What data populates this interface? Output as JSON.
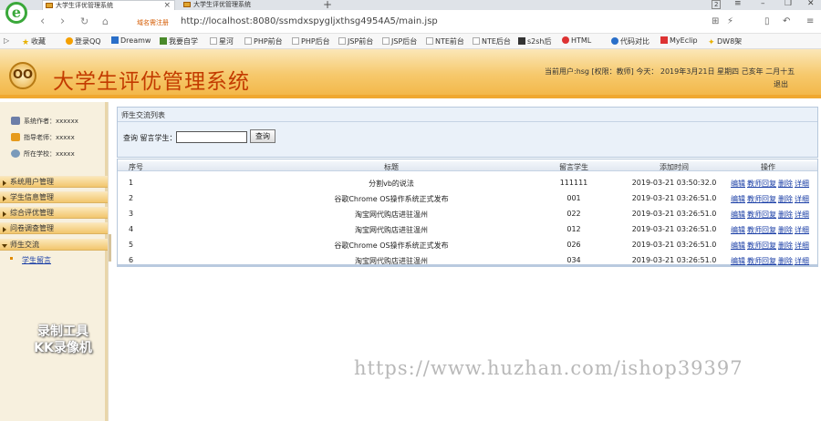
{
  "browser": {
    "tabs": [
      {
        "title": "大学生评优管理系统"
      },
      {
        "title": "大学生评优管理系统"
      }
    ],
    "new_tab": "+",
    "tab_close": "×",
    "window_counter": "2",
    "address_warning": "域名需注册",
    "url": "http://localhost:8080/ssmdxspygljxthsg4954A5/main.jsp",
    "bookmarks": [
      {
        "label": "收藏",
        "icon": "star-icon"
      },
      {
        "label": "登录QQ",
        "icon": "qq-icon"
      },
      {
        "label": "Dreamw",
        "icon": "dreamweaver-icon"
      },
      {
        "label": "我要自学",
        "icon": "book-icon"
      },
      {
        "label": "星河",
        "icon": "page-icon"
      },
      {
        "label": "PHP前台",
        "icon": "page-icon"
      },
      {
        "label": "PHP后台",
        "icon": "page-icon"
      },
      {
        "label": "JSP前台",
        "icon": "page-icon"
      },
      {
        "label": "JSP后台",
        "icon": "page-icon"
      },
      {
        "label": "NTE前台",
        "icon": "page-icon"
      },
      {
        "label": "NTE后台",
        "icon": "page-icon"
      },
      {
        "label": "s2sh后",
        "icon": "image-icon"
      },
      {
        "label": "HTML",
        "icon": "html-icon"
      },
      {
        "label": "代码对比",
        "icon": "chrome-icon"
      },
      {
        "label": "MyEclip",
        "icon": "myeclipse-icon"
      },
      {
        "label": "DW8架",
        "icon": "settings-icon"
      }
    ]
  },
  "header": {
    "logo_text": "OO",
    "title": "大学生评优管理系统",
    "user_info": "当前用户:hsg [权限：教师] 今天：  2019年3月21日 星期四 己亥年 二月十五",
    "logout": "退出"
  },
  "sidebar": {
    "info": [
      {
        "label": "系统作者：xxxxxx",
        "icon": "user-icon"
      },
      {
        "label": "指导老师：xxxxx",
        "icon": "teacher-icon"
      },
      {
        "label": "所在学校：xxxxx",
        "icon": "school-icon"
      }
    ],
    "menu": [
      {
        "label": "系统用户管理"
      },
      {
        "label": "学生信息管理"
      },
      {
        "label": "综合评优管理"
      },
      {
        "label": "问卷调查管理"
      },
      {
        "label": "师生交流"
      }
    ],
    "submenu_item": "学生留言"
  },
  "panel": {
    "title": "师生交流列表",
    "search_label": "查询 留言学生：",
    "search_value": "",
    "search_button": "查询"
  },
  "table": {
    "headers": {
      "no": "序号",
      "title": "标题",
      "student": "留言学生",
      "time": "添加时间",
      "ops": "操作"
    },
    "op_labels": [
      "编辑",
      "教师回复",
      "删除",
      "详细"
    ],
    "rows": [
      {
        "no": "1",
        "title": "分割vb的说法",
        "student": "111111",
        "time": "2019-03-21 03:50:32.0"
      },
      {
        "no": "2",
        "title": "谷歌Chrome OS操作系统正式发布",
        "student": "001",
        "time": "2019-03-21 03:26:51.0"
      },
      {
        "no": "3",
        "title": "淘宝网代购店进驻温州",
        "student": "022",
        "time": "2019-03-21 03:26:51.0"
      },
      {
        "no": "4",
        "title": "淘宝网代购店进驻温州",
        "student": "012",
        "time": "2019-03-21 03:26:51.0"
      },
      {
        "no": "5",
        "title": "谷歌Chrome OS操作系统正式发布",
        "student": "026",
        "time": "2019-03-21 03:26:51.0"
      },
      {
        "no": "6",
        "title": "淘宝网代购店进驻温州",
        "student": "034",
        "time": "2019-03-21 03:26:51.0"
      }
    ]
  },
  "watermarks": {
    "left_line1": "录制工具",
    "left_line2": "KK录像机",
    "right": "https://www.huzhan.com/ishop39397"
  }
}
